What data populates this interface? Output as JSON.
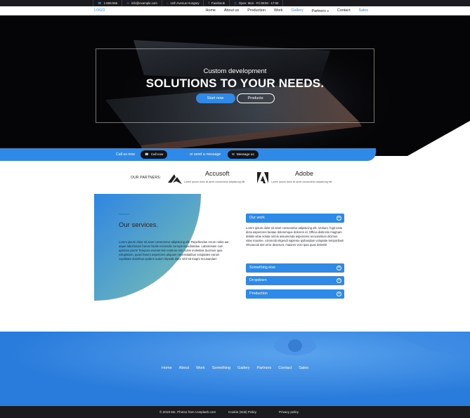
{
  "topbar": {
    "items": [
      {
        "icon": "phone-icon",
        "glyph": "☎",
        "text": "1-555-555"
      },
      {
        "icon": "mail-icon",
        "glyph": "✉",
        "text": "info@example.com"
      },
      {
        "icon": "home-icon",
        "glyph": "⌂",
        "text": "11th Avenue Hungary"
      },
      {
        "icon": "facebook-icon",
        "glyph": "f",
        "text": "Facebook"
      },
      {
        "icon": "clock-icon",
        "glyph": "◷",
        "text": "Open: Mon - Fri 08:00 - 17:00"
      }
    ]
  },
  "nav": {
    "logo": "LOGO",
    "items": [
      "Home",
      "About us",
      "Production",
      "Work",
      "Gallery",
      "Partners",
      "Contact",
      "Sales"
    ],
    "active": "Gallery",
    "dropdown_caret": "▾"
  },
  "hero": {
    "subtitle": "Custom development",
    "title": "SOLUTIONS TO YOUR NEEDS.",
    "primary_button": "Start now",
    "secondary_button": "Products"
  },
  "callbar": {
    "call_text": "Call us now",
    "call_button": "Call now",
    "message_text": "or send a message",
    "message_button": "Message us"
  },
  "partners": {
    "label": "OUR PARTNERS:",
    "items": [
      {
        "name": "Accusoft",
        "desc": "Lorem ipsum dolor sit amet consectetur adipisicing elit."
      },
      {
        "name": "Adobe",
        "desc": "Lorem ipsum dolor sit amet consectetur adipisicing elit."
      }
    ]
  },
  "services": {
    "eyebrow": "Introduce",
    "title": "Our services.",
    "text": "Lorem ipsum dolor sit amet consectetur adipisicing elit. Repellendus rerum nobis aut atque laboriosam harum facilis reiciendis corrupti repudiandae. Laboriosam cum aperiam porro! Tempora eveniet iste nostrum rem nobis molestias ducimus quia voluptatem, quasi harum asperiores aliquam necessitatibus voluptates earum cupiditate doloribus quidem autem impedit dolor nihil sit magni recusandae!"
  },
  "accordion": {
    "items": [
      "Our work",
      "Something else",
      "Dropdown",
      "Production"
    ],
    "open_body": "Lorem ipsum dolor sit amet consectetur adipisicing elit. Veniam, fugit iusto dicta asperiores beatae doloremque dolorem id. Officia distinctio magnam debitis vitae soluta omnis assumenda asperiores accusantium dicimus vitae maxime, commodi eligendi sapiente quibusdam voluptate temporibus! Obcaecati sint error deserunt, maiores vero quia quas deleniti!",
    "plus_glyph": "+"
  },
  "footer": {
    "menu": [
      "Home",
      "About",
      "Work",
      "Something",
      "Gallery",
      "Partners",
      "Contact",
      "Sales"
    ],
    "copyright": "© 2019 Me. Photos from Unsplash.com",
    "cookie": "Cookie (Süti) Policy",
    "privacy": "Privacy policy"
  },
  "colors": {
    "accent": "#2e8ae6",
    "dark": "#1b1b1f",
    "hero_bg": "#050507"
  }
}
